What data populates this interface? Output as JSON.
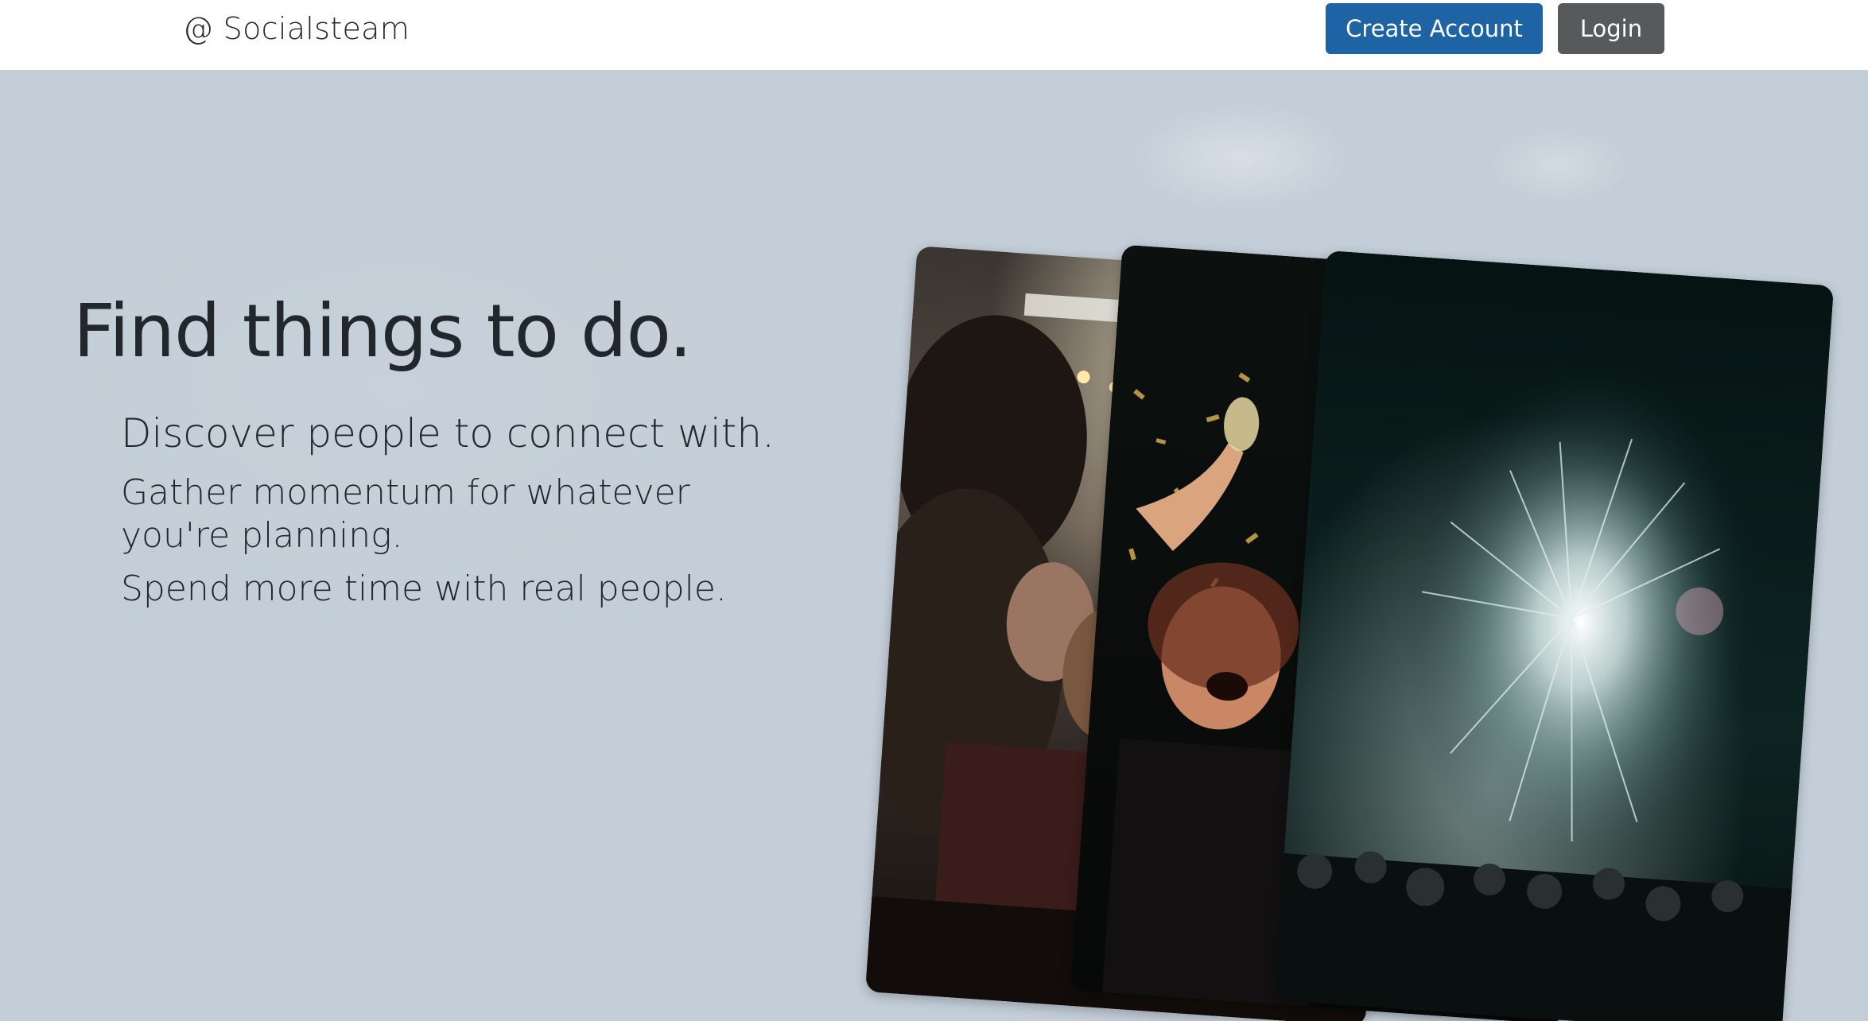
{
  "navbar": {
    "brand": "@ Socialsteam",
    "create_account_label": "Create Account",
    "login_label": "Login"
  },
  "hero": {
    "headline": "Find things to do.",
    "line1": "Discover people to connect with.",
    "line2": "Gather momentum for whatever you're planning.",
    "line3": "Spend more time with real people."
  },
  "colors": {
    "primary": "#1e63a3",
    "secondary": "#58595a",
    "hero_background": "#c4ced8",
    "text": "#22262d"
  }
}
